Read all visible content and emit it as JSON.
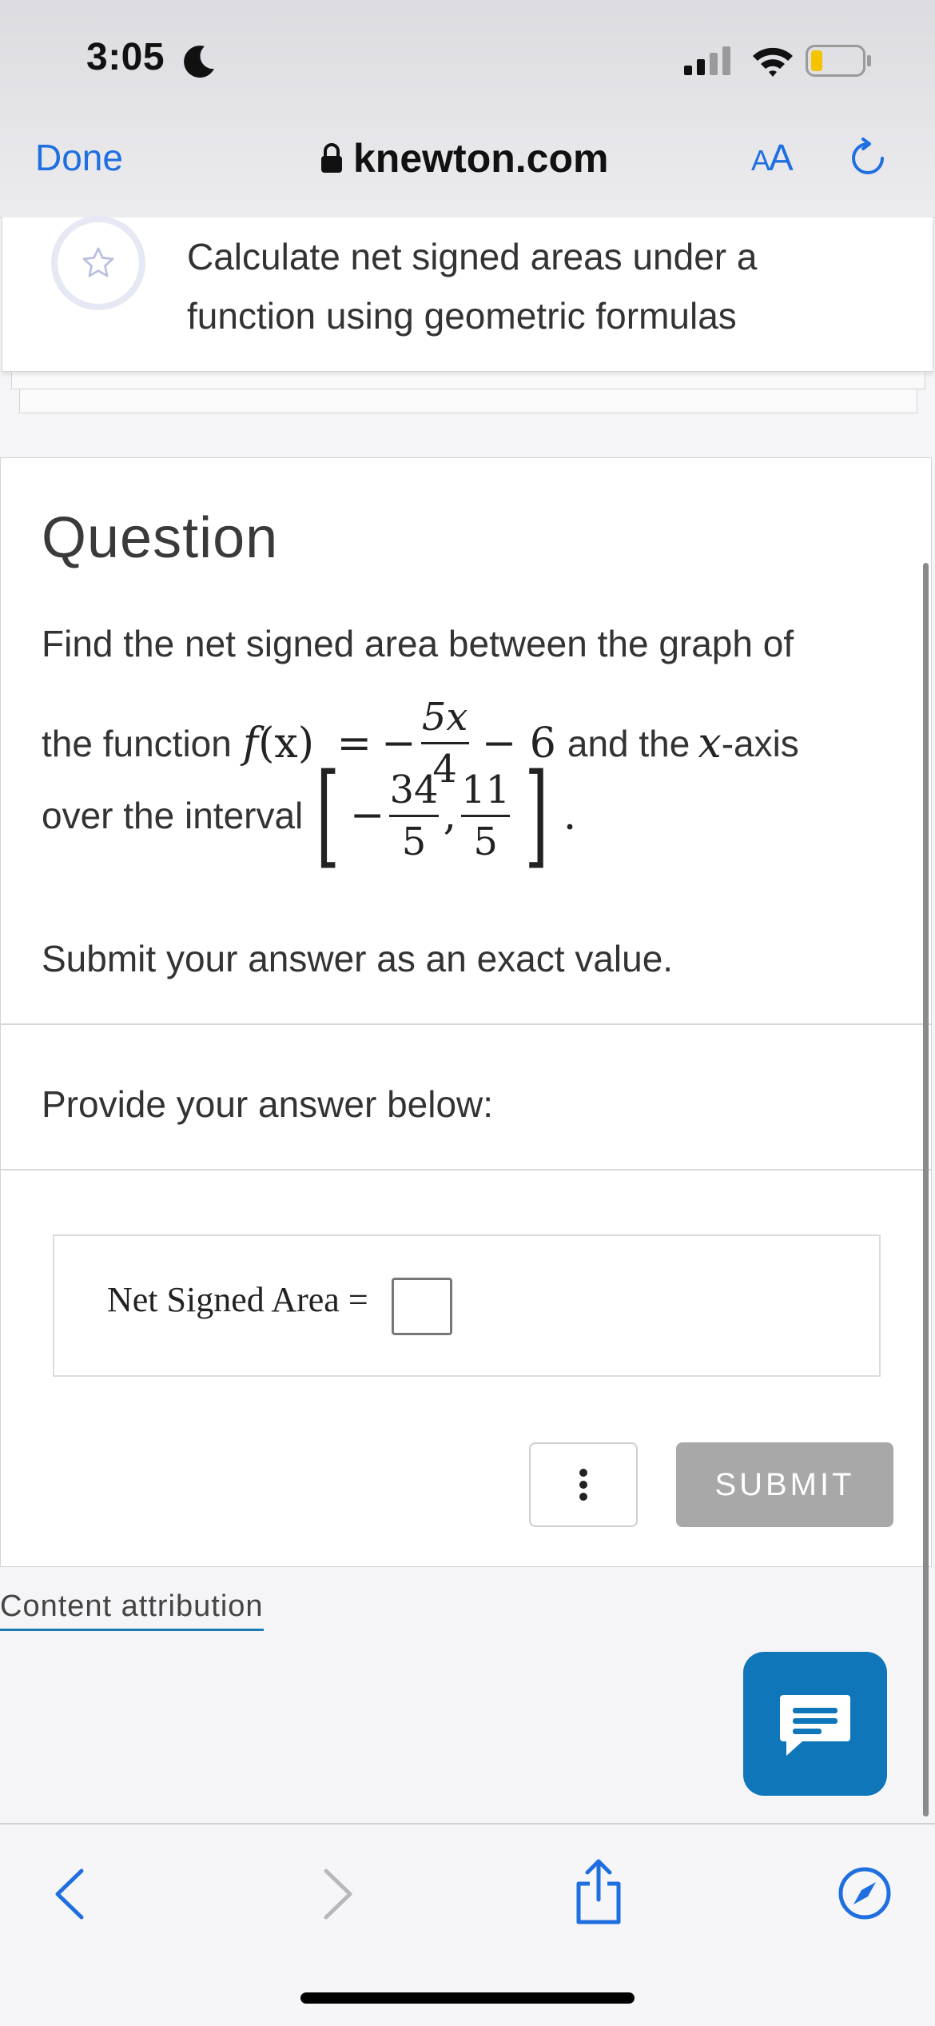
{
  "status_bar": {
    "time": "3:05"
  },
  "browser": {
    "done_label": "Done",
    "url": "knewton.com",
    "text_size_small": "A",
    "text_size_large": "A"
  },
  "objective": {
    "text": "Calculate net signed areas under a function using geometric formulas"
  },
  "question": {
    "heading": "Question",
    "line1": "Find the net signed area between the graph of",
    "line2_prefix": "the function",
    "func_name": "f",
    "func_arg": "(x)",
    "equals": "=",
    "minus": "−",
    "coef_num": "5x",
    "coef_den": "4",
    "const_term": "− 6",
    "line2_and": "and the",
    "axis_var": "x",
    "axis_suffix": "-axis",
    "line3_prefix": "over the interval",
    "interval_minus": "−",
    "a_num": "34",
    "a_den": "5",
    "comma": ",",
    "b_num": "11",
    "b_den": "5",
    "period": ".",
    "submit_note": "Submit your answer as an exact value."
  },
  "answer": {
    "prompt": "Provide your answer below:",
    "label": "Net Signed Area =",
    "value": ""
  },
  "actions": {
    "submit_label": "SUBMIT"
  },
  "footer": {
    "attribution": "Content attribution"
  },
  "colors": {
    "accent_blue": "#1f6fe0",
    "chat_blue": "#0e76b9",
    "submit_disabled": "#a8a8a8"
  }
}
